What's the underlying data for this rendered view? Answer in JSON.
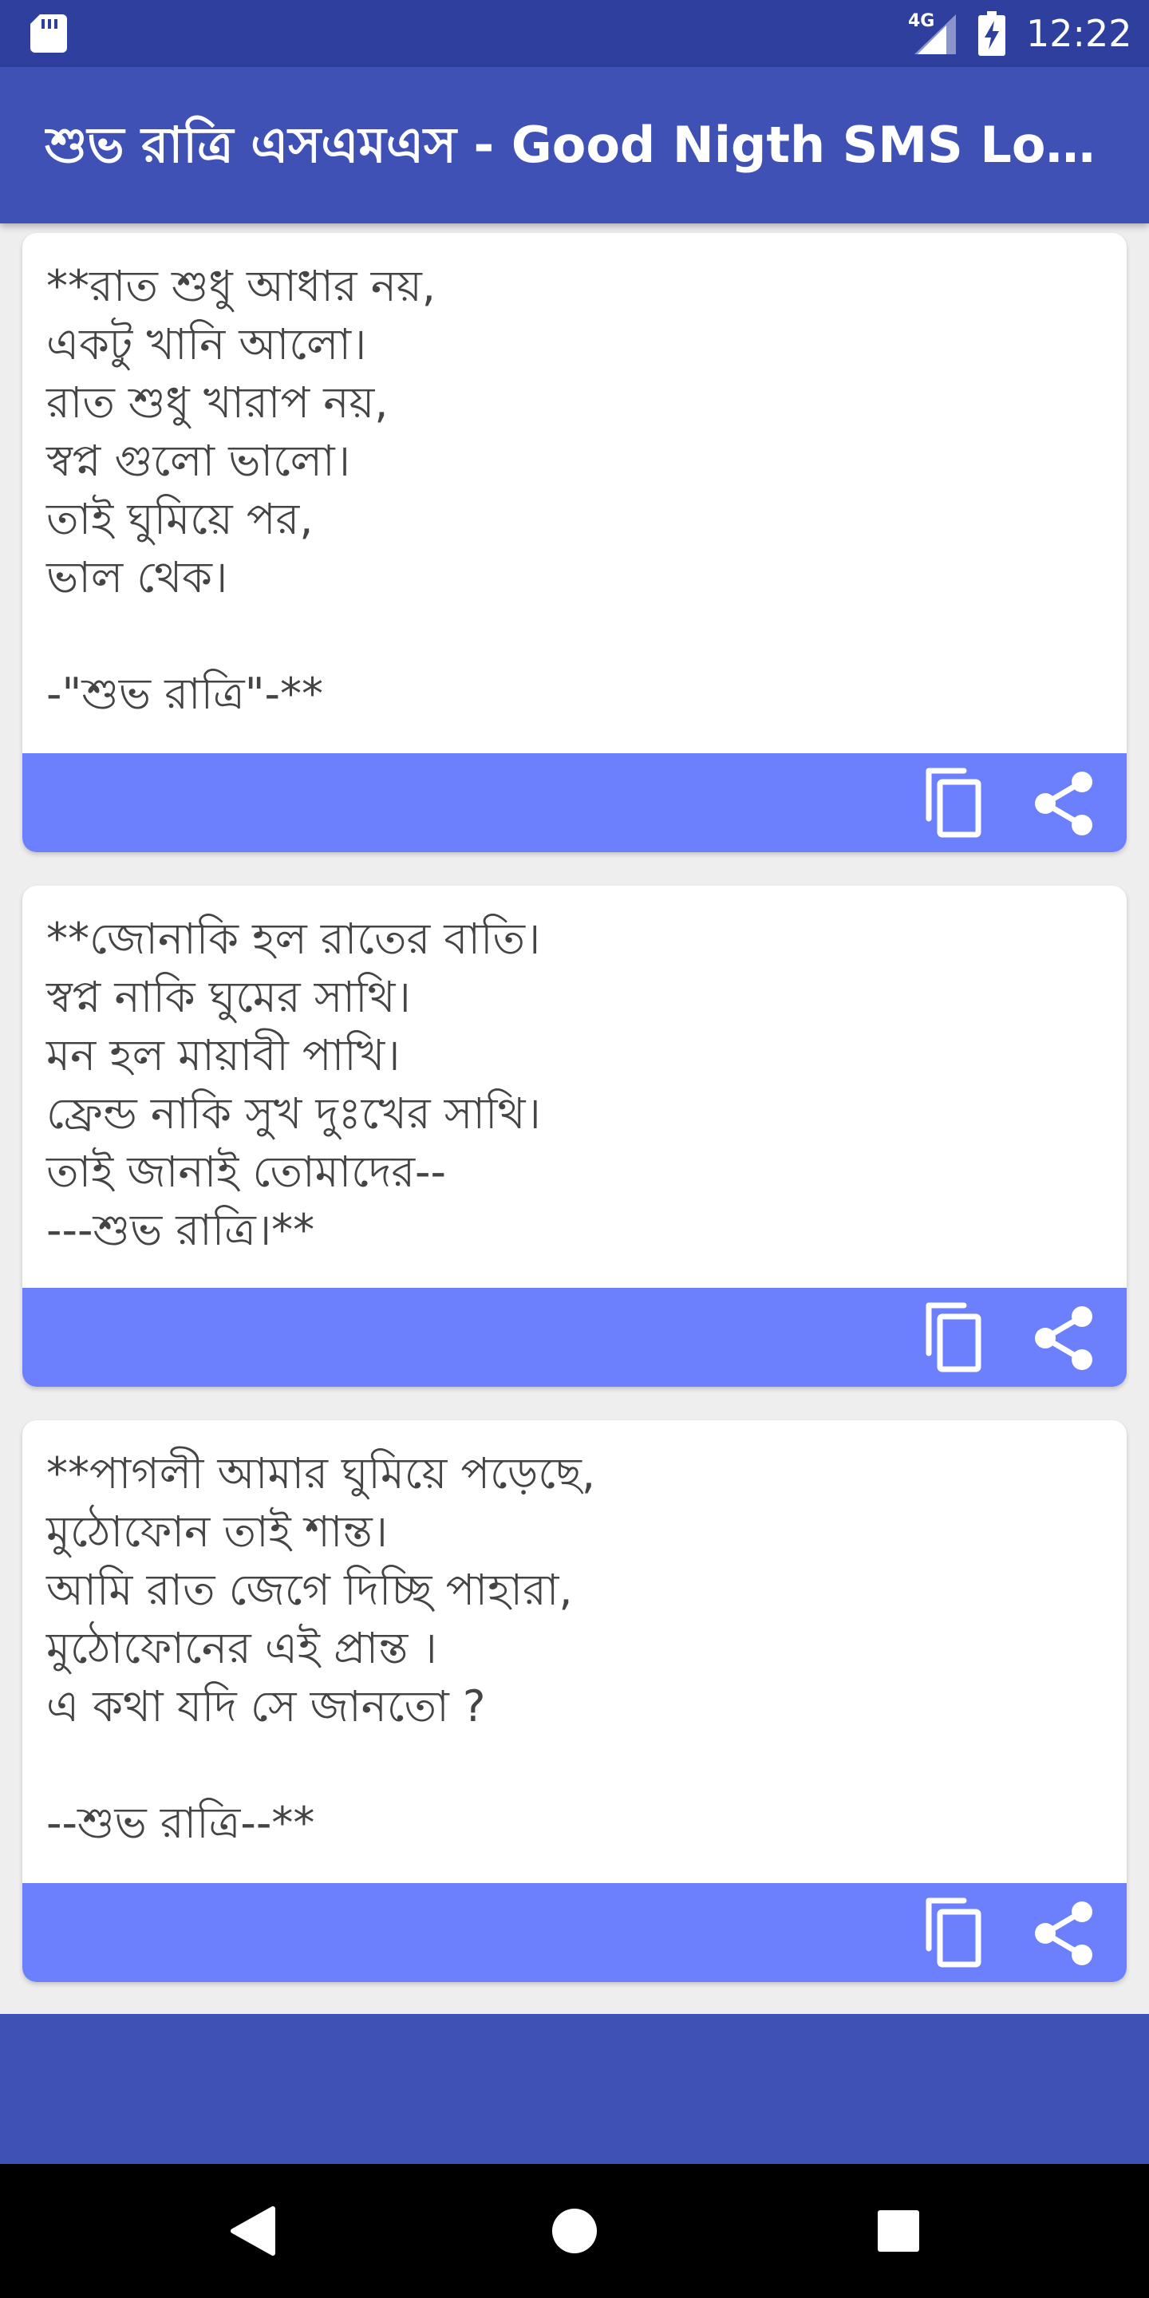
{
  "status_bar": {
    "network": "4G",
    "time": "12:22",
    "icons": [
      "sd-card-icon",
      "signal-icon",
      "battery-charging-icon"
    ]
  },
  "app_bar": {
    "title": "শুভ রাত্রি এসএমএস - Good Nigth SMS Lo…"
  },
  "cards": [
    {
      "text": "**রাত শুধু আধার নয়,\nএকটু খানি আলো।\nরাত শুধু খারাপ নয়,\nস্বপ্ন গুলো ভালো।\nতাই ঘুমিয়ে পর,\nভাল থেক।\n\n-\"শুভ রাত্রি\"-**",
      "copy_icon": "copy-icon",
      "share_icon": "share-icon"
    },
    {
      "text": "**জোনাকি হল রাতের বাতি।\nস্বপ্ন নাকি ঘুমের সাথি।\nমন হল মায়াবী পাখি।\nফ্রেন্ড নাকি সুখ দুঃখের সাথি।\nতাই জানাই তোমাদের--\n---শুভ রাত্রি।**",
      "copy_icon": "copy-icon",
      "share_icon": "share-icon"
    },
    {
      "text": "**পাগলী আমার ঘুমিয়ে পড়েছে,\nমুঠোফোন তাই শান্ত।\nআমি রাত জেগে দিচ্ছি পাহারা,\nমুঠোফোনের এই প্রান্ত ।\nএ কথা যদি সে জানতো ?\n\n--শুভ রাত্রি--**",
      "copy_icon": "copy-icon",
      "share_icon": "share-icon"
    }
  ],
  "nav_bar": {
    "icons": [
      "back-icon",
      "home-icon",
      "recents-icon"
    ]
  },
  "colors": {
    "status_bar": "#2e3f9e",
    "app_bar": "#3f51b5",
    "card_action_bar": "#6c7ffc",
    "background": "#eeeeee"
  }
}
